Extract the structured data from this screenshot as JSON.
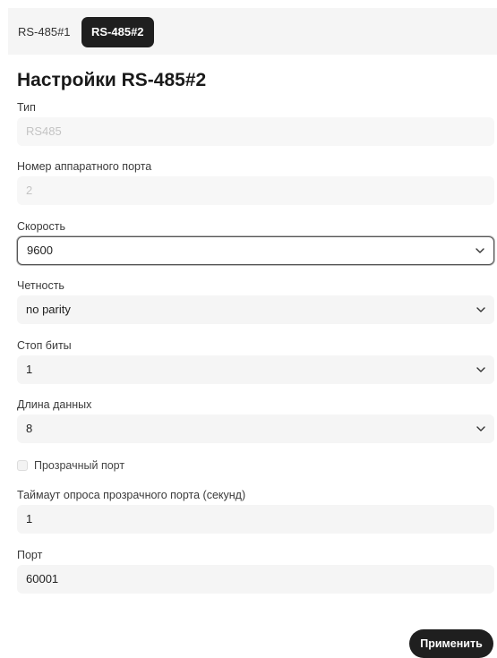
{
  "tabs": [
    {
      "label": "RS-485#1",
      "active": false
    },
    {
      "label": "RS-485#2",
      "active": true
    }
  ],
  "title": "Настройки RS-485#2",
  "fields": {
    "type": {
      "label": "Тип",
      "value": "RS485",
      "disabled": true
    },
    "hw_port": {
      "label": "Номер аппаратного порта",
      "value": "2",
      "disabled": true
    },
    "speed": {
      "label": "Скорость",
      "value": "9600"
    },
    "parity": {
      "label": "Четность",
      "value": "no parity"
    },
    "stop_bits": {
      "label": "Стоп биты",
      "value": "1"
    },
    "data_length": {
      "label": "Длина данных",
      "value": "8"
    },
    "transparent": {
      "label": "Прозрачный порт",
      "checked": false
    },
    "timeout": {
      "label": "Таймаут опроса прозрачного порта (секунд)",
      "value": "1"
    },
    "port": {
      "label": "Порт",
      "value": "60001"
    }
  },
  "apply_label": "Применить",
  "icons": {
    "select_arrow": "chevron-down-icon"
  },
  "colors": {
    "dark": "#1f1f1f",
    "field_bg": "#f5f5f5",
    "disabled_text": "#c4c4c4"
  }
}
